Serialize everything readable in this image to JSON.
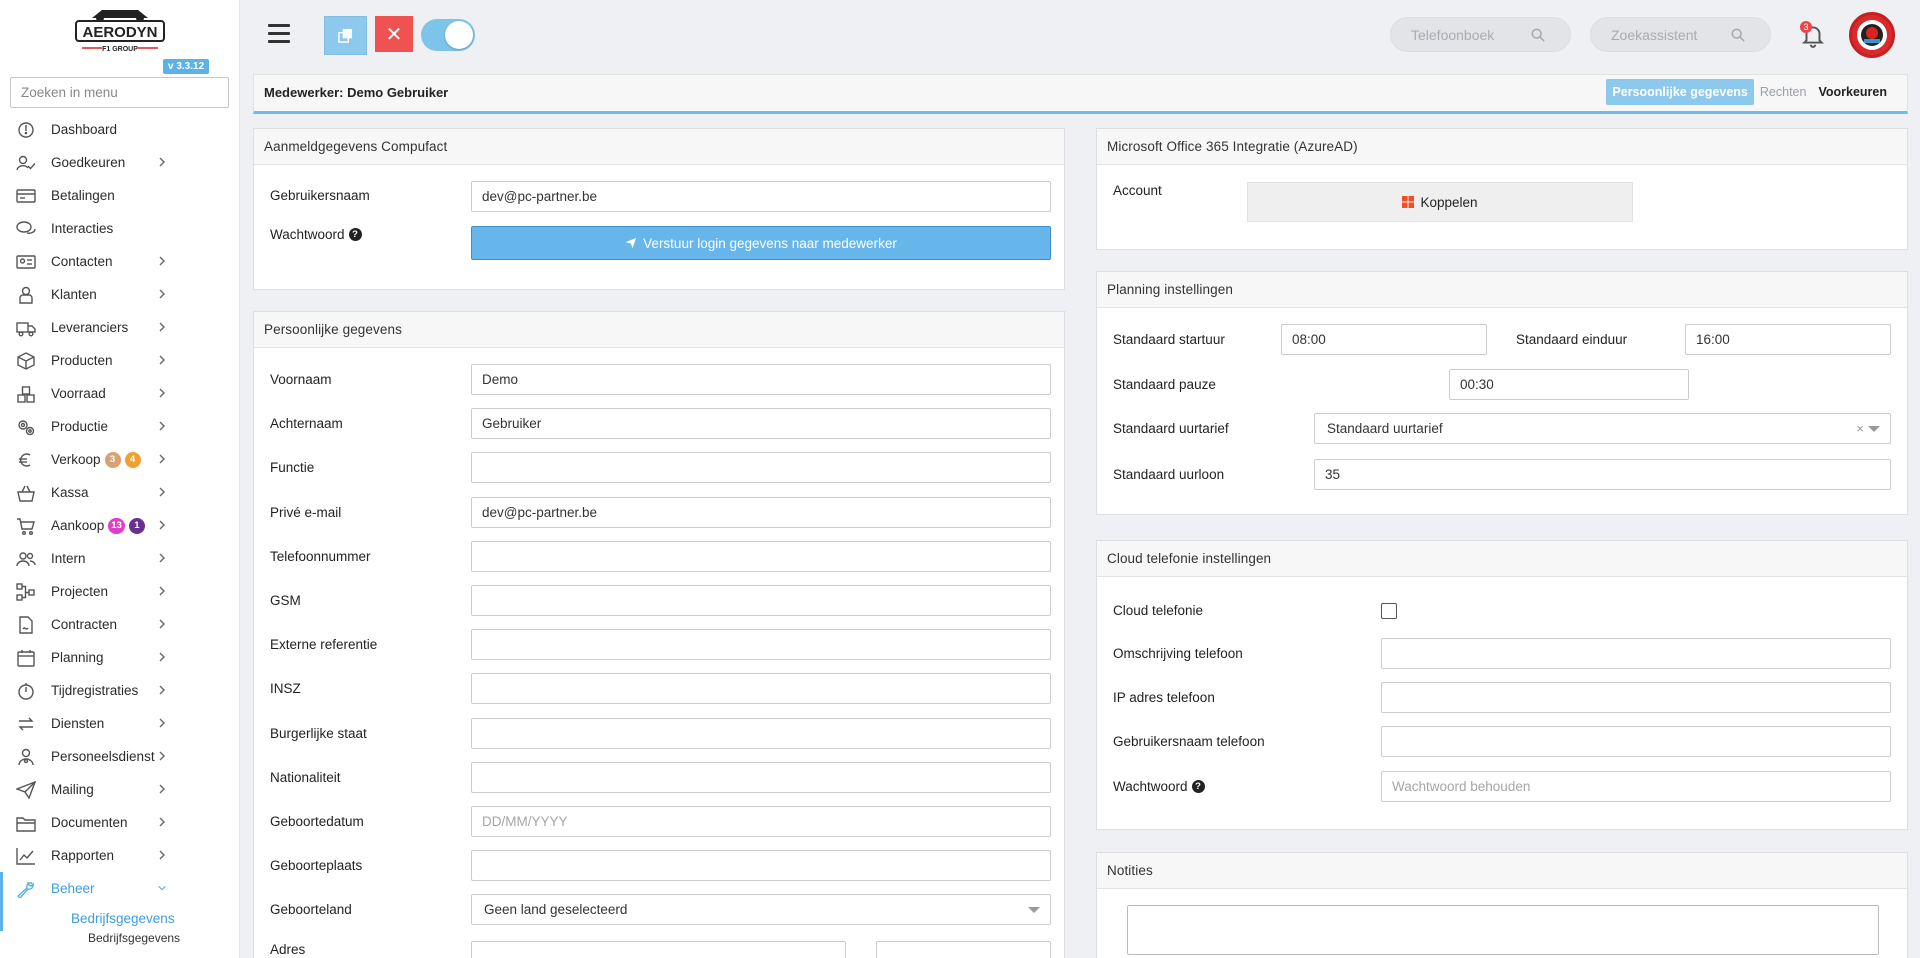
{
  "brand": {
    "logo_text": "AERODYN",
    "logo_subtext": "F1 GROUP",
    "version": "v 3.3.12"
  },
  "sidebar": {
    "search_placeholder": "Zoeken in menu",
    "items": [
      {
        "label": "Dashboard",
        "icon": "dashboard-icon",
        "chevron": false
      },
      {
        "label": "Goedkeuren",
        "icon": "approve-icon",
        "chevron": true
      },
      {
        "label": "Betalingen",
        "icon": "payments-icon",
        "chevron": false
      },
      {
        "label": "Interacties",
        "icon": "chat-icon",
        "chevron": false
      },
      {
        "label": "Contacten",
        "icon": "contact-card-icon",
        "chevron": true
      },
      {
        "label": "Klanten",
        "icon": "customer-icon",
        "chevron": true
      },
      {
        "label": "Leveranciers",
        "icon": "truck-icon",
        "chevron": true
      },
      {
        "label": "Producten",
        "icon": "box-icon",
        "chevron": true
      },
      {
        "label": "Voorraad",
        "icon": "boxes-icon",
        "chevron": true
      },
      {
        "label": "Productie",
        "icon": "gears-icon",
        "chevron": true
      },
      {
        "label": "Verkoop",
        "icon": "euro-icon",
        "chevron": true
      },
      {
        "label": "Kassa",
        "icon": "basket-icon",
        "chevron": true
      },
      {
        "label": "Aankoop",
        "icon": "cart-icon",
        "chevron": true
      },
      {
        "label": "Intern",
        "icon": "users-icon",
        "chevron": true
      },
      {
        "label": "Projecten",
        "icon": "project-icon",
        "chevron": true
      },
      {
        "label": "Contracten",
        "icon": "contract-icon",
        "chevron": true
      },
      {
        "label": "Planning",
        "icon": "calendar-icon",
        "chevron": true
      },
      {
        "label": "Tijdregistraties",
        "icon": "timer-icon",
        "chevron": true
      },
      {
        "label": "Diensten",
        "icon": "exchange-icon",
        "chevron": true
      },
      {
        "label": "Personeelsdienst",
        "icon": "staff-icon",
        "chevron": true
      },
      {
        "label": "Mailing",
        "icon": "paper-plane-icon",
        "chevron": true
      },
      {
        "label": "Documenten",
        "icon": "folder-icon",
        "chevron": true
      },
      {
        "label": "Rapporten",
        "icon": "chart-line-icon",
        "chevron": true
      },
      {
        "label": "Beheer",
        "icon": "wrench-icon",
        "chevron": true
      }
    ],
    "badges": {
      "verkoop_1": "3",
      "verkoop_2": "4",
      "aankoop_1": "13",
      "aankoop_2": "1"
    },
    "sub_item": "Bedrijfsgegevens",
    "sub_sub_item": "Bedrijfsgegevens"
  },
  "topbar": {
    "phonebook_placeholder": "Telefoonboek",
    "assistant_placeholder": "Zoekassistent",
    "notification_count": "3"
  },
  "header": {
    "title": "Medewerker: Demo Gebruiker",
    "tabs": [
      "Persoonlijke gegevens",
      "Rechten",
      "Voorkeuren"
    ]
  },
  "login_panel": {
    "title": "Aanmeldgegevens Compufact",
    "username_label": "Gebruikersnaam",
    "username_value": "dev@pc-partner.be",
    "password_label": "Wachtwoord",
    "send_button": "Verstuur login gegevens naar medewerker"
  },
  "personal_panel": {
    "title": "Persoonlijke gegevens",
    "fields": [
      {
        "label": "Voornaam",
        "value": "Demo",
        "placeholder": ""
      },
      {
        "label": "Achternaam",
        "value": "Gebruiker",
        "placeholder": ""
      },
      {
        "label": "Functie",
        "value": "",
        "placeholder": ""
      },
      {
        "label": "Privé e-mail",
        "value": "dev@pc-partner.be",
        "placeholder": ""
      },
      {
        "label": "Telefoonnummer",
        "value": "",
        "placeholder": ""
      },
      {
        "label": "GSM",
        "value": "",
        "placeholder": ""
      },
      {
        "label": "Externe referentie",
        "value": "",
        "placeholder": ""
      },
      {
        "label": "INSZ",
        "value": "",
        "placeholder": ""
      },
      {
        "label": "Burgerlijke staat",
        "value": "",
        "placeholder": ""
      },
      {
        "label": "Nationaliteit",
        "value": "",
        "placeholder": ""
      },
      {
        "label": "Geboortedatum",
        "value": "",
        "placeholder": "DD/MM/YYYY"
      },
      {
        "label": "Geboorteplaats",
        "value": "",
        "placeholder": ""
      }
    ],
    "country_label": "Geboorteland",
    "country_value": "Geen land geselecteerd",
    "address_label": "Adres"
  },
  "azure_panel": {
    "title": "Microsoft Office 365 Integratie (AzureAD)",
    "account_label": "Account",
    "connect_button": "Koppelen"
  },
  "planning_panel": {
    "title": "Planning instellingen",
    "start_label": "Standaard startuur",
    "start_value": "08:00",
    "end_label": "Standaard einduur",
    "end_value": "16:00",
    "pause_label": "Standaard pauze",
    "pause_value": "00:30",
    "rate_label": "Standaard uurtarief",
    "rate_value": "Standaard uurtarief",
    "wage_label": "Standaard uurloon",
    "wage_value": "35"
  },
  "cloud_panel": {
    "title": "Cloud telefonie instellingen",
    "cloud_label": "Cloud telefonie",
    "desc_label": "Omschrijving telefoon",
    "ip_label": "IP adres telefoon",
    "user_label": "Gebruikersnaam telefoon",
    "password_label": "Wachtwoord",
    "password_placeholder": "Wachtwoord behouden"
  },
  "notes_panel": {
    "title": "Notities"
  },
  "colors": {
    "accent": "#5cb1e6",
    "danger": "#f05151",
    "badge_orange": "#f0a030",
    "badge_tan": "#d9a070",
    "badge_pink": "#e040c8",
    "badge_purple": "#6a3090"
  }
}
